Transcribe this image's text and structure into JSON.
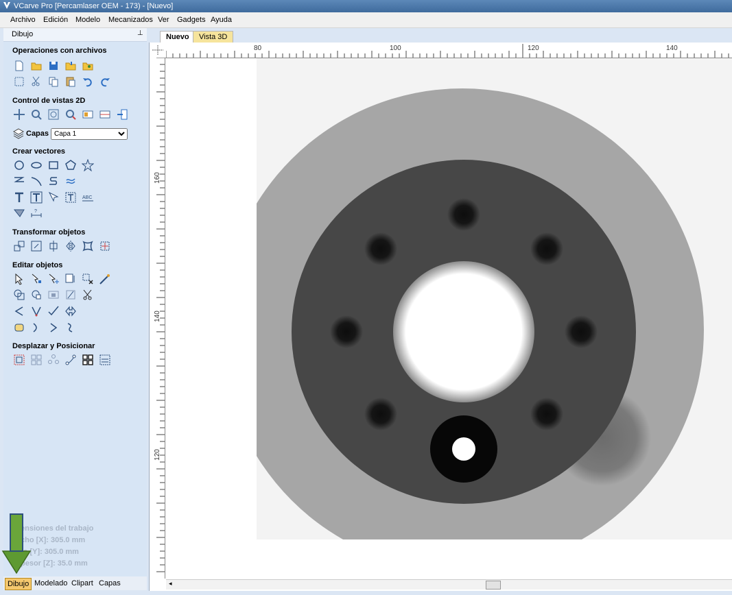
{
  "window": {
    "title": "VCarve Pro [Percamlaser OEM - 173) - [Nuevo]"
  },
  "menu": [
    "Archivo",
    "Edición",
    "Modelo",
    "Mecanizados",
    "Ver",
    "Gadgets",
    "Ayuda"
  ],
  "panel": {
    "title": "Dibujo",
    "pin_glyph": "⊥",
    "sections": {
      "files": "Operaciones con archivos",
      "view2d": "Control de vistas 2D",
      "layers_label": "Capas",
      "layer_value": "Capa 1",
      "vectors": "Crear vectores",
      "transform": "Transformar objetos",
      "edit": "Editar objetos",
      "arrange": "Desplazar y Posicionar"
    },
    "job": {
      "title": "ensiones del trabajo",
      "width": "cho  [X]: 305.0 mm",
      "height": "to    [Y]: 305.0 mm",
      "thickness": "pesor [Z]: 35.0 mm"
    }
  },
  "bottom_tabs": [
    "Dibujo",
    "Modelado",
    "Clipart",
    "Capas"
  ],
  "doc_tabs": [
    "Nuevo",
    "Vista 3D"
  ],
  "rulers": {
    "h_labels": [
      "80",
      "100",
      "120",
      "140"
    ],
    "v_labels": [
      "160",
      "140",
      "120"
    ]
  },
  "colors": {
    "highlight_tab": "#f5c86e",
    "arrow": "#5e9a32",
    "disc_outer": "#a6a6a6",
    "disc_inner": "#474747",
    "hole": "#111111"
  }
}
